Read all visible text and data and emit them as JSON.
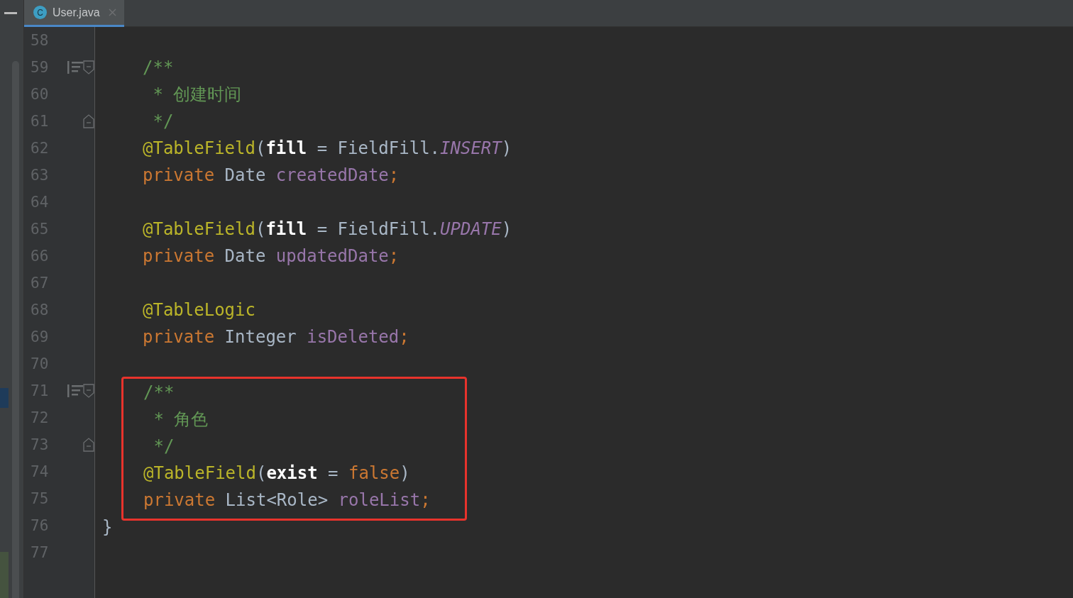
{
  "tab": {
    "icon_letter": "C",
    "label": "User.java",
    "selected": true
  },
  "groups": [
    {
      "highlighted": false,
      "lines": [
        {
          "number": "58"
        },
        {
          "number": "59",
          "kind": "body",
          "doc_icon": true,
          "fold_start": true,
          "tokens": [
            {
              "t": "/**",
              "kind": "comment"
            }
          ]
        },
        {
          "number": "60",
          "kind": "body",
          "tokens": [
            {
              "t": " * 创建时间",
              "kind": "comment"
            }
          ]
        },
        {
          "number": "61",
          "kind": "body",
          "fold_end": true,
          "tokens": [
            {
              "t": " */",
              "kind": "comment"
            }
          ]
        },
        {
          "number": "62",
          "kind": "body",
          "tokens": [
            {
              "t": "@TableField",
              "kind": "annotation"
            },
            {
              "t": "(",
              "kind": "plain"
            },
            {
              "t": "fill",
              "kind": "param"
            },
            {
              "t": " = FieldFill.",
              "kind": "plain"
            },
            {
              "t": "INSERT",
              "kind": "constant"
            },
            {
              "t": ")",
              "kind": "plain"
            }
          ]
        },
        {
          "number": "63",
          "kind": "body",
          "tokens": [
            {
              "t": "private ",
              "kind": "keyword"
            },
            {
              "t": "Date ",
              "kind": "plain"
            },
            {
              "t": "createdDate",
              "kind": "field"
            },
            {
              "t": ";",
              "kind": "keyword"
            }
          ]
        },
        {
          "number": "64"
        },
        {
          "number": "65",
          "kind": "body",
          "tokens": [
            {
              "t": "@TableField",
              "kind": "annotation"
            },
            {
              "t": "(",
              "kind": "plain"
            },
            {
              "t": "fill",
              "kind": "param"
            },
            {
              "t": " = FieldFill.",
              "kind": "plain"
            },
            {
              "t": "UPDATE",
              "kind": "constant"
            },
            {
              "t": ")",
              "kind": "plain"
            }
          ]
        },
        {
          "number": "66",
          "kind": "body",
          "tokens": [
            {
              "t": "private ",
              "kind": "keyword"
            },
            {
              "t": "Date ",
              "kind": "plain"
            },
            {
              "t": "updatedDate",
              "kind": "field"
            },
            {
              "t": ";",
              "kind": "keyword"
            }
          ]
        },
        {
          "number": "67"
        },
        {
          "number": "68",
          "kind": "body",
          "tokens": [
            {
              "t": "@TableLogic",
              "kind": "annotation"
            }
          ]
        },
        {
          "number": "69",
          "kind": "body",
          "tokens": [
            {
              "t": "private ",
              "kind": "keyword"
            },
            {
              "t": "Integer ",
              "kind": "plain"
            },
            {
              "t": "isDeleted",
              "kind": "field"
            },
            {
              "t": ";",
              "kind": "keyword"
            }
          ]
        },
        {
          "number": "70"
        }
      ]
    },
    {
      "highlighted": true,
      "lines": [
        {
          "number": "71",
          "kind": "body",
          "doc_icon": true,
          "fold_start": true,
          "tokens": [
            {
              "t": "/**",
              "kind": "comment"
            }
          ]
        },
        {
          "number": "72",
          "kind": "body",
          "tokens": [
            {
              "t": " * 角色",
              "kind": "comment"
            }
          ]
        },
        {
          "number": "73",
          "kind": "body",
          "fold_end": true,
          "tokens": [
            {
              "t": " */",
              "kind": "comment"
            }
          ]
        },
        {
          "number": "74",
          "kind": "body",
          "tokens": [
            {
              "t": "@TableField",
              "kind": "annotation"
            },
            {
              "t": "(",
              "kind": "plain"
            },
            {
              "t": "exist",
              "kind": "param"
            },
            {
              "t": " = ",
              "kind": "plain"
            },
            {
              "t": "false",
              "kind": "keyword"
            },
            {
              "t": ")",
              "kind": "plain"
            }
          ]
        },
        {
          "number": "75",
          "kind": "body",
          "tokens": [
            {
              "t": "private ",
              "kind": "keyword"
            },
            {
              "t": "List<Role> ",
              "kind": "plain"
            },
            {
              "t": "roleList",
              "kind": "field"
            },
            {
              "t": ";",
              "kind": "keyword"
            }
          ]
        }
      ]
    },
    {
      "highlighted": false,
      "lines": [
        {
          "number": "76",
          "kind": "closing",
          "tokens": [
            {
              "t": "}",
              "kind": "plain"
            }
          ]
        },
        {
          "number": "77"
        }
      ]
    }
  ]
}
